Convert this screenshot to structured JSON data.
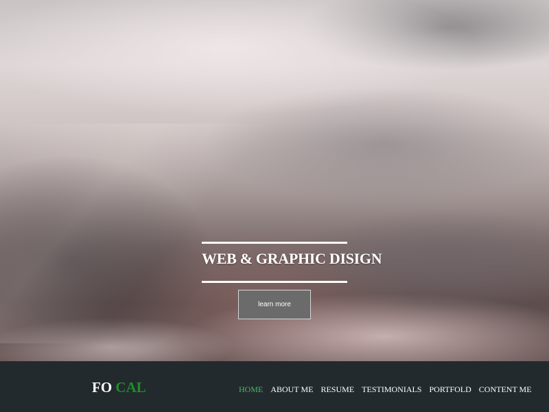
{
  "hero": {
    "tagline": "WEB & GRAPHIC DISIGN",
    "cta_label": "learn more"
  },
  "brand": {
    "part1": "FO",
    "part2": "CAL",
    "accent_color": "#1e8e2a"
  },
  "nav": {
    "items": [
      {
        "label": "HOME",
        "active": true
      },
      {
        "label": "ABOUT ME",
        "active": false
      },
      {
        "label": "RESUME",
        "active": false
      },
      {
        "label": "TESTIMONIALS",
        "active": false
      },
      {
        "label": "PORTFOLD",
        "active": false
      },
      {
        "label": "CONTENT ME",
        "active": false
      }
    ],
    "active_color": "#3fbf5f"
  }
}
